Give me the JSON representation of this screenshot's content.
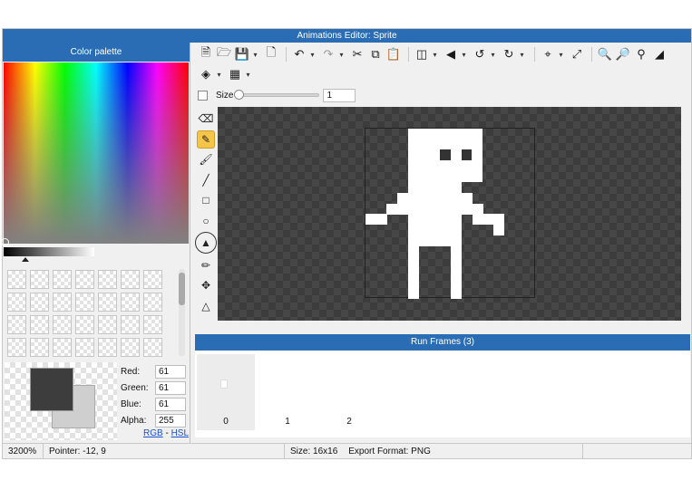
{
  "window": {
    "title": "Animations Editor: Sprite"
  },
  "palette": {
    "title": "Color palette",
    "fields": [
      {
        "label": "Red:",
        "value": "61"
      },
      {
        "label": "Green:",
        "value": "61"
      },
      {
        "label": "Blue:",
        "value": "61"
      },
      {
        "label": "Alpha:",
        "value": "255"
      }
    ],
    "links": {
      "rgb": "RGB",
      "separator": " - ",
      "hsl": "HSL"
    },
    "colors": {
      "primary": "#3d3d3d",
      "secondary": "#cfcfcf"
    }
  },
  "toolbar": {
    "row1": [
      "new-file",
      "open-folder",
      "save",
      "save-as",
      "undo",
      "redo",
      "cut",
      "copy",
      "paste",
      "flip-horizontal",
      "flip-vertical",
      "rotate-left",
      "rotate-right",
      "crop",
      "resize",
      "zoom-in",
      "zoom-out",
      "zoom-fit",
      "fill-canvas"
    ],
    "row2": [
      "layers",
      "grid"
    ]
  },
  "brush": {
    "size_label": "Size",
    "size_value": "1"
  },
  "tools": [
    "eraser",
    "pencil",
    "brush",
    "line",
    "rectangle",
    "ellipse",
    "fill-bucket",
    "eyedropper",
    "move",
    "transform"
  ],
  "active_tool": "pencil",
  "frames": {
    "title": "Run Frames (3)",
    "items": [
      "0",
      "1",
      "2"
    ],
    "selected": "0"
  },
  "status": {
    "zoom": "3200%",
    "pointer": "Pointer: -12, 9",
    "size": "Size: 16x16",
    "export": "Export Format: PNG"
  },
  "sprite": {
    "fill_color": "#ffffff",
    "eye_color": "#333333",
    "background_color": "#3c3c3c"
  }
}
